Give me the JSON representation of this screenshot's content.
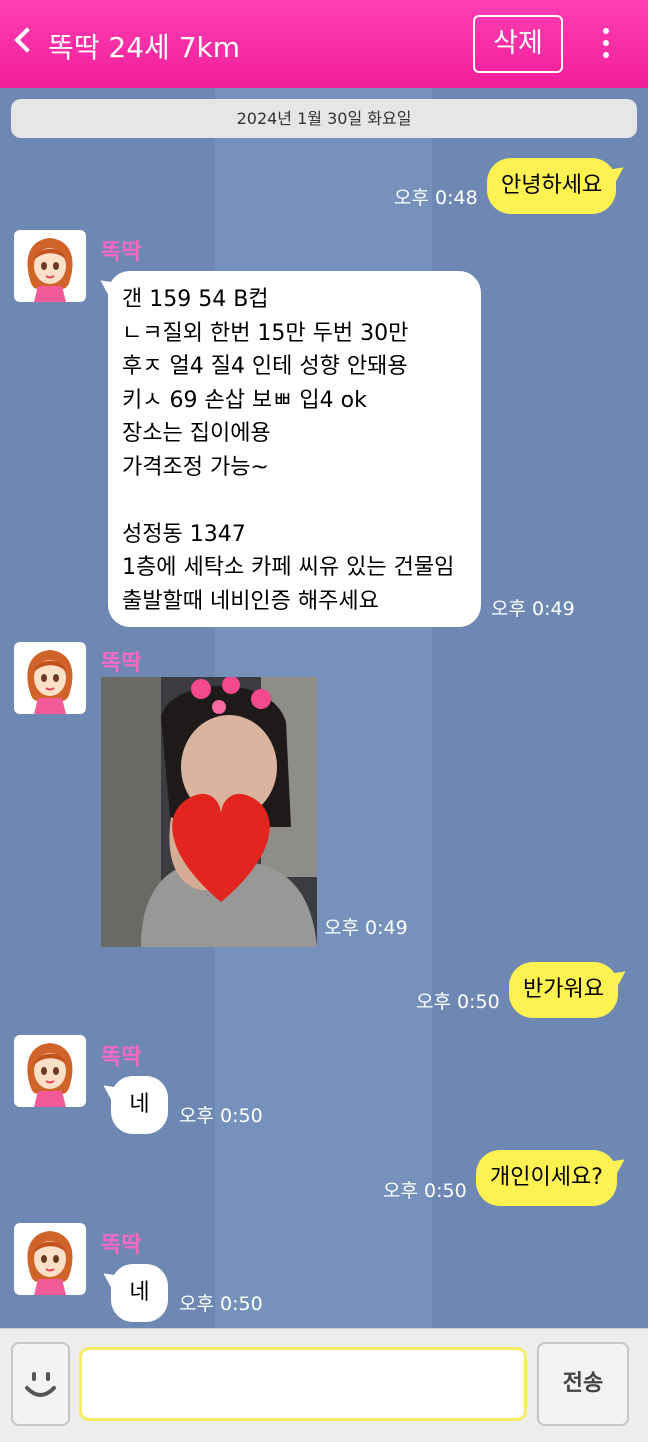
{
  "header": {
    "title": "똑딱 24세 7km",
    "delete_label": "삭제",
    "accent_color": "#f21e9a"
  },
  "chat": {
    "date": "2024년 1월 30일 화요일",
    "sender_name": "똑딱",
    "messages": [
      {
        "from": "me",
        "text": "안녕하세요",
        "time": "오후 0:48"
      },
      {
        "from": "them",
        "text": "갠 159 54 B컵\nㄴㅋ질외 한번 15만 두번 30만\n후ㅈ 얼4 질4 인테 성향 안돼용\n키ㅅ 69 손삽 보ㅃ 입4 ok\n장소는 집이에용\n가격조정 가능~\n\n성정동 1347\n1층에 세탁소 카페 씨유 있는 건물임\n출발할때 네비인증 해주세요",
        "time": "오후 0:49"
      },
      {
        "from": "them",
        "type": "photo",
        "time": "오후 0:49"
      },
      {
        "from": "me",
        "text": "반가워요",
        "time": "오후 0:50"
      },
      {
        "from": "them",
        "text": "네",
        "time": "오후 0:50"
      },
      {
        "from": "me",
        "text": "개인이세요?",
        "time": "오후 0:50"
      },
      {
        "from": "them",
        "text": "네",
        "time": "오후 0:50"
      }
    ]
  },
  "composer": {
    "input_value": "",
    "send_label": "전송"
  }
}
